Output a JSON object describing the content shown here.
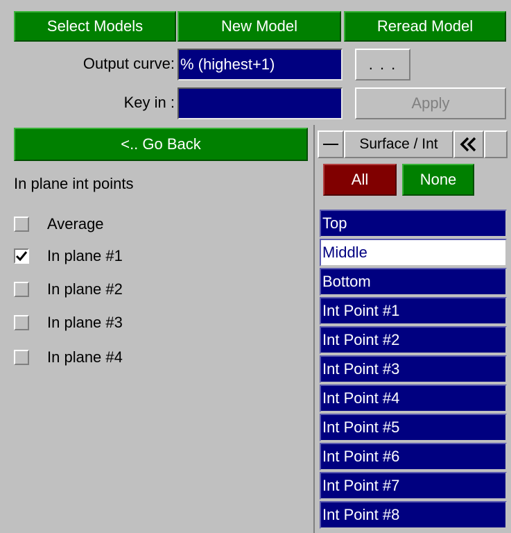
{
  "toolbar": {
    "select_models": "Select Models",
    "new_model": "New Model",
    "reread_model": "Reread Model"
  },
  "output_curve": {
    "label": "Output curve:",
    "value": "% (highest+1)",
    "browse_label": ". . ."
  },
  "key_in": {
    "label": "Key in :",
    "value": "",
    "apply_label": "Apply"
  },
  "go_back": "<.. Go Back",
  "section_title": "In plane int points",
  "checkboxes": [
    {
      "label": "Average",
      "checked": false
    },
    {
      "label": "In plane #1",
      "checked": true
    },
    {
      "label": "In plane #2",
      "checked": false
    },
    {
      "label": "In plane #3",
      "checked": false
    },
    {
      "label": "In plane #4",
      "checked": false
    }
  ],
  "right_panel": {
    "header_title": "Surface / Int",
    "collapse_icon": "double-chevron-left",
    "all_label": "All",
    "none_label": "None",
    "colors": {
      "all": "#800000",
      "none": "#008000",
      "selected": "#000080",
      "unselected": "#ffffff"
    },
    "items": [
      {
        "label": "Top",
        "selected": true
      },
      {
        "label": "Middle",
        "selected": false
      },
      {
        "label": "Bottom",
        "selected": true
      },
      {
        "label": "Int Point #1",
        "selected": true
      },
      {
        "label": "Int Point #2",
        "selected": true
      },
      {
        "label": "Int Point #3",
        "selected": true
      },
      {
        "label": "Int Point #4",
        "selected": true
      },
      {
        "label": "Int Point #5",
        "selected": true
      },
      {
        "label": "Int Point #6",
        "selected": true
      },
      {
        "label": "Int Point #7",
        "selected": true
      },
      {
        "label": "Int Point #8",
        "selected": true
      }
    ]
  }
}
